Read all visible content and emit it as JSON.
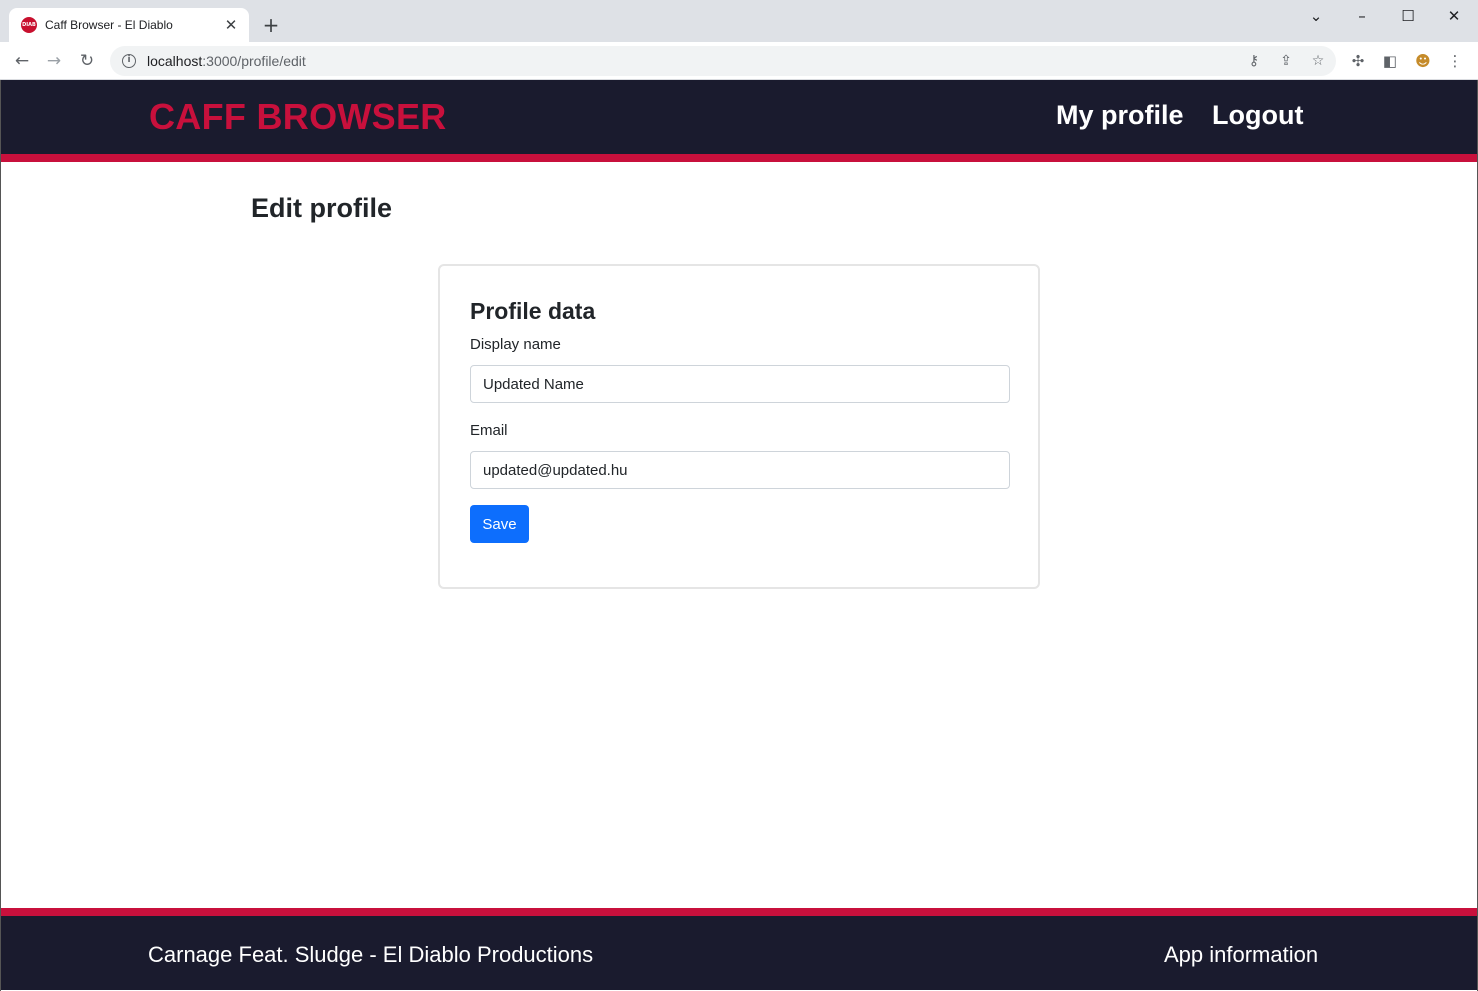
{
  "browser": {
    "tab_title": "Caff Browser - El Diablo",
    "favicon_text": "DIAB",
    "url_host": "localhost",
    "url_path": ":3000/profile/edit"
  },
  "header": {
    "brand": "CAFF BROWSER",
    "nav": {
      "my_profile": "My profile",
      "logout": "Logout"
    }
  },
  "page": {
    "title": "Edit profile"
  },
  "form": {
    "card_title": "Profile data",
    "display_name_label": "Display name",
    "display_name_value": "Updated Name",
    "email_label": "Email",
    "email_value": "updated@updated.hu",
    "save_label": "Save"
  },
  "footer": {
    "credits": "Carnage Feat. Sludge - El Diablo Productions",
    "app_info": "App information"
  },
  "colors": {
    "header_bg": "#1a1b2e",
    "accent": "#c8103c",
    "primary_button": "#0d6efd"
  }
}
